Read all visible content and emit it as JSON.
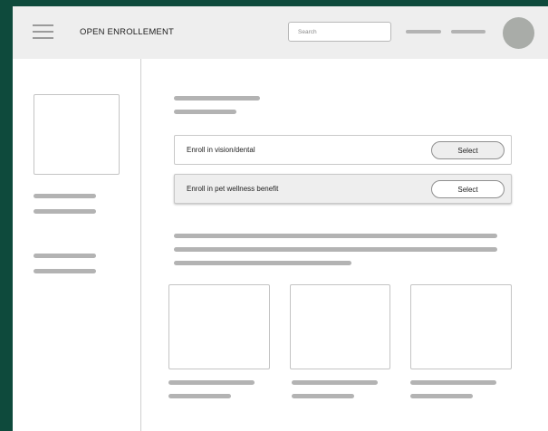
{
  "header": {
    "title": "OPEN ENROLLEMENT",
    "search_placeholder": "Search",
    "menu_icon": "hamburger-icon",
    "avatar_icon": "avatar-circle"
  },
  "options": [
    {
      "label": "Enroll in vision/dental",
      "button": "Select",
      "highlighted": false
    },
    {
      "label": "Enroll in pet wellness benefit",
      "button": "Select",
      "highlighted": true
    }
  ],
  "colors": {
    "frame": "#0e4a3c",
    "header_bg": "#eeeeee",
    "placeholder_bar": "#b3b3b3",
    "avatar": "#a9aca8"
  }
}
